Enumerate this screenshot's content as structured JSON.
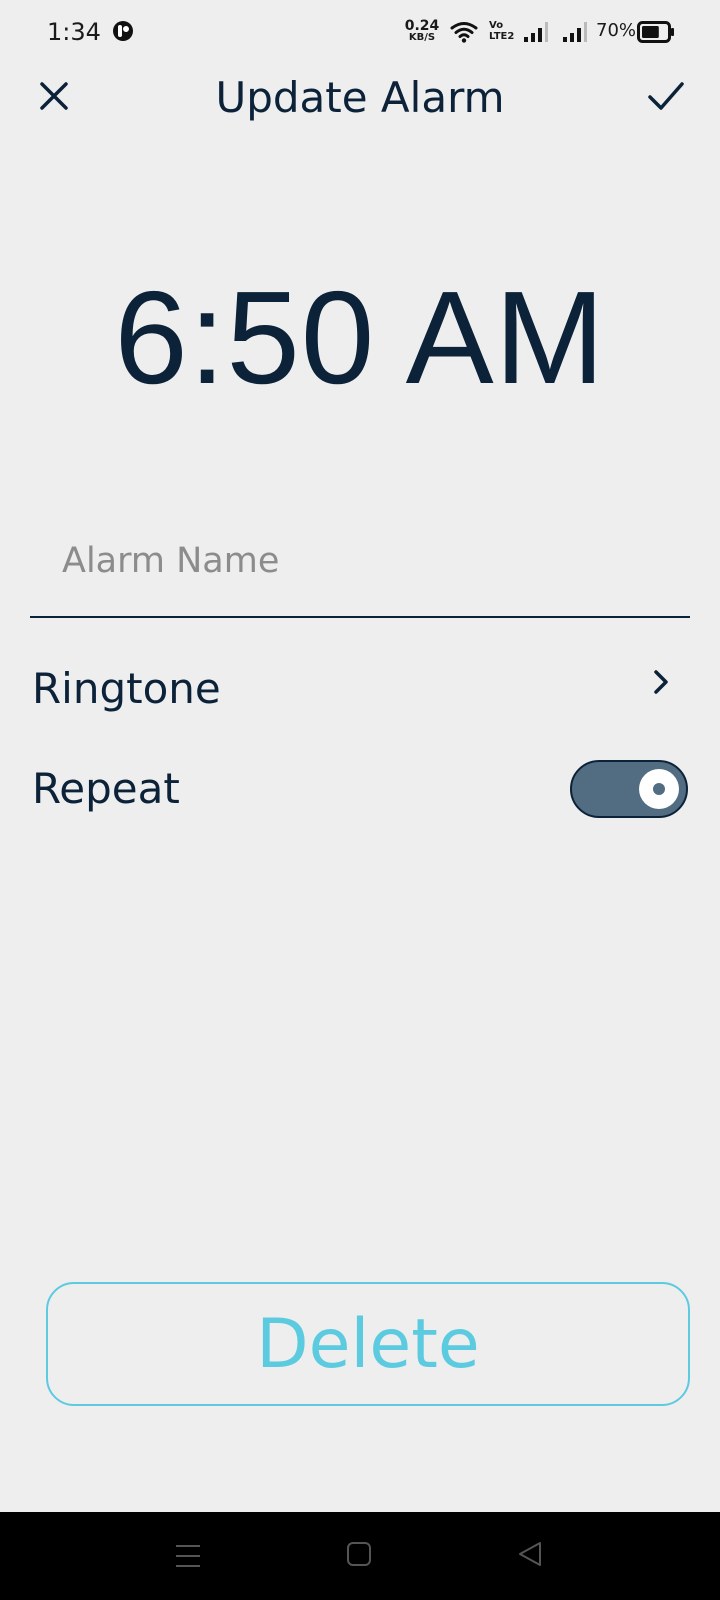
{
  "status_bar": {
    "time": "1:34",
    "net_speed_value": "0.24",
    "net_speed_unit": "KB/S",
    "volte_top": "Vo",
    "volte_bottom": "LTE2",
    "battery_percent": "70%",
    "battery_level": 0.7,
    "icons": [
      "app-notification-icon",
      "wifi-icon",
      "volte-icon",
      "signal-icon",
      "signal-icon",
      "battery-icon"
    ]
  },
  "header": {
    "title": "Update Alarm",
    "close_icon": "close-icon",
    "confirm_icon": "check-icon"
  },
  "alarm": {
    "time": "6:50 AM",
    "name_value": "",
    "name_placeholder": "Alarm Name",
    "ringtone_label": "Ringtone",
    "ringtone_icon": "chevron-right-icon",
    "repeat_label": "Repeat",
    "repeat_on": true
  },
  "actions": {
    "delete_label": "Delete"
  },
  "nav_bar": {
    "icons": [
      "menu-icon",
      "home-icon",
      "back-icon"
    ]
  },
  "colors": {
    "background": "#eeeeee",
    "text_primary": "#0b2239",
    "placeholder": "#8c8c8c",
    "toggle_track": "#526c82",
    "delete_accent": "#5ccbe0",
    "nav_bar": "#000000"
  }
}
